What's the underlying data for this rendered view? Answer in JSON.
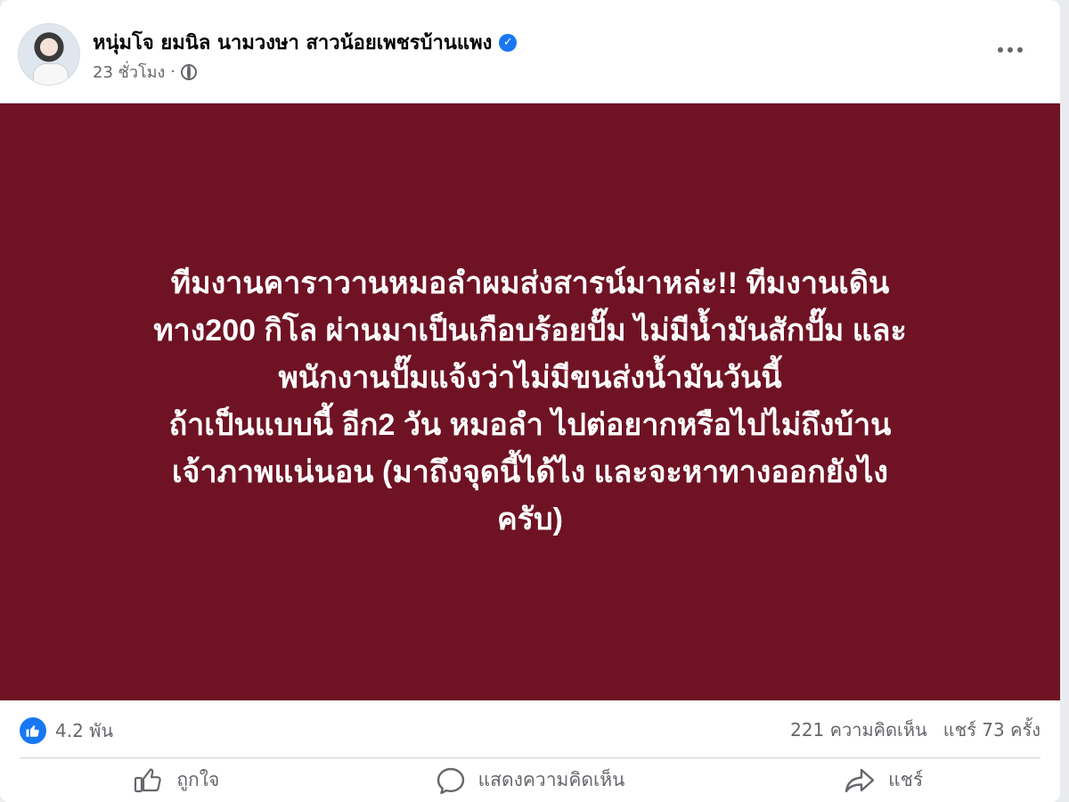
{
  "post": {
    "author": "หนุ่มโจ ยมนิล นามวงษา สาวน้อยเพชรบ้านแพง",
    "time": "23 ชั่วโมง",
    "separator": "·",
    "body": "ทีมงานคาราวานหมอลำผมส่งสารน์มาหล่ะ!! ทีมงานเดิน\nทาง200 กิโล ผ่านมาเป็นเกือบร้อยปั๊ม ไม่มีน้ำมันสักปั๊ม และ\nพนักงานปั๊มแจ้งว่าไม่มีขนส่งน้ำมันวันนี้\nถ้าเป็นแบบนี้ อีก2 วัน หมอลำ ไปต่อยากหรือไปไม่ถึงบ้าน\nเจ้าภาพแน่นอน (มาถึงจุดนี้ได้ไง และจะหาทางออกยังไง\nครับ)",
    "background_color": "#6f1324"
  },
  "stats": {
    "reactions": "4.2 พัน",
    "comments": "221 ความคิดเห็น",
    "shares": "แชร์ 73 ครั้ง"
  },
  "actions": {
    "like_label": "ถูกใจ",
    "comment_label": "แสดงความคิดเห็น",
    "share_label": "แชร์"
  },
  "icons": {
    "verified": "verified-badge-icon",
    "audience": "globe-icon",
    "more": "more-options-icon",
    "reaction": "like-reaction-icon",
    "like": "thumbs-up-icon",
    "comment": "comment-bubble-icon",
    "share": "share-arrow-icon"
  },
  "colors": {
    "accent": "#1877f2",
    "text_secondary": "#65676b"
  }
}
